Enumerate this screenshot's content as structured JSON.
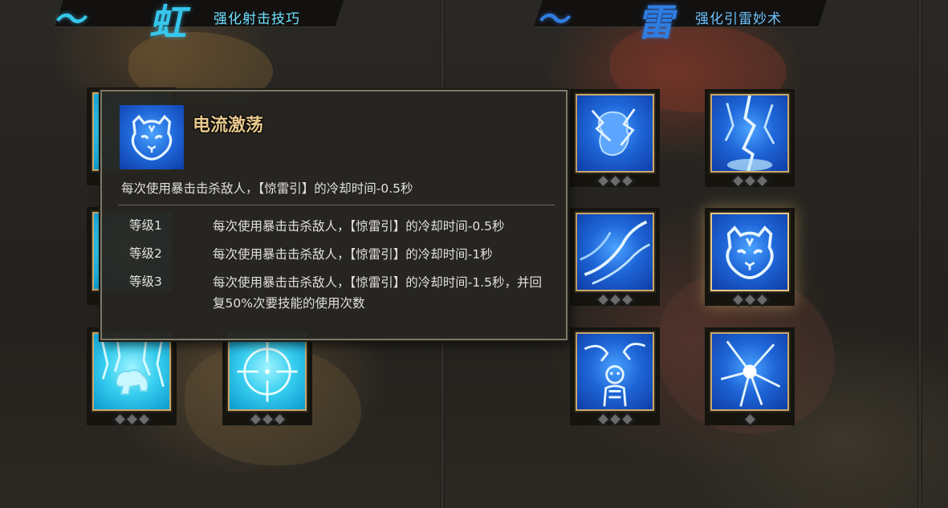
{
  "colors": {
    "accent_gold": "#e7c78c",
    "tile_border": "#caa86c",
    "cyan_skill": "#3ad0f0",
    "blue_skill": "#1f66d8",
    "header_text": "#6ec4ff",
    "pip_inactive": "#6b6b6b"
  },
  "headers": {
    "left": {
      "glyph": "虹",
      "label": "强化射击技巧"
    },
    "right": {
      "glyph": "雷",
      "label": "强化引雷妙术"
    }
  },
  "skills": {
    "left": [
      {
        "icon": "bear-lightning-icon",
        "pips": 3,
        "color": "cyan"
      },
      {
        "icon": "crosshair-icon",
        "pips": 3,
        "color": "cyan"
      }
    ],
    "right": [
      {
        "icon": "lightning-pot-icon",
        "pips": 3,
        "color": "blue"
      },
      {
        "icon": "lightning-strike-icon",
        "pips": 3,
        "color": "blue"
      },
      {
        "icon": "lightning-swirl-icon",
        "pips": 3,
        "color": "blue"
      },
      {
        "icon": "tiger-face-icon",
        "pips": 3,
        "color": "blue",
        "selected": true
      },
      {
        "icon": "shocked-person-icon",
        "pips": 3,
        "color": "blue"
      },
      {
        "icon": "lightning-burst-icon",
        "pips": 1,
        "color": "blue"
      }
    ]
  },
  "tooltip": {
    "icon": "tiger-face-icon",
    "title": "电流激荡",
    "description": "每次使用暴击击杀敌人，【惊雷引】的冷却时间-0.5秒",
    "levels": [
      {
        "name": "等级1",
        "text": "每次使用暴击击杀敌人，【惊雷引】的冷却时间-0.5秒"
      },
      {
        "name": "等级2",
        "text": "每次使用暴击击杀敌人，【惊雷引】的冷却时间-1秒"
      },
      {
        "name": "等级3",
        "text": "每次使用暴击击杀敌人，【惊雷引】的冷却时间-1.5秒，并回复50%次要技能的使用次数"
      }
    ]
  }
}
